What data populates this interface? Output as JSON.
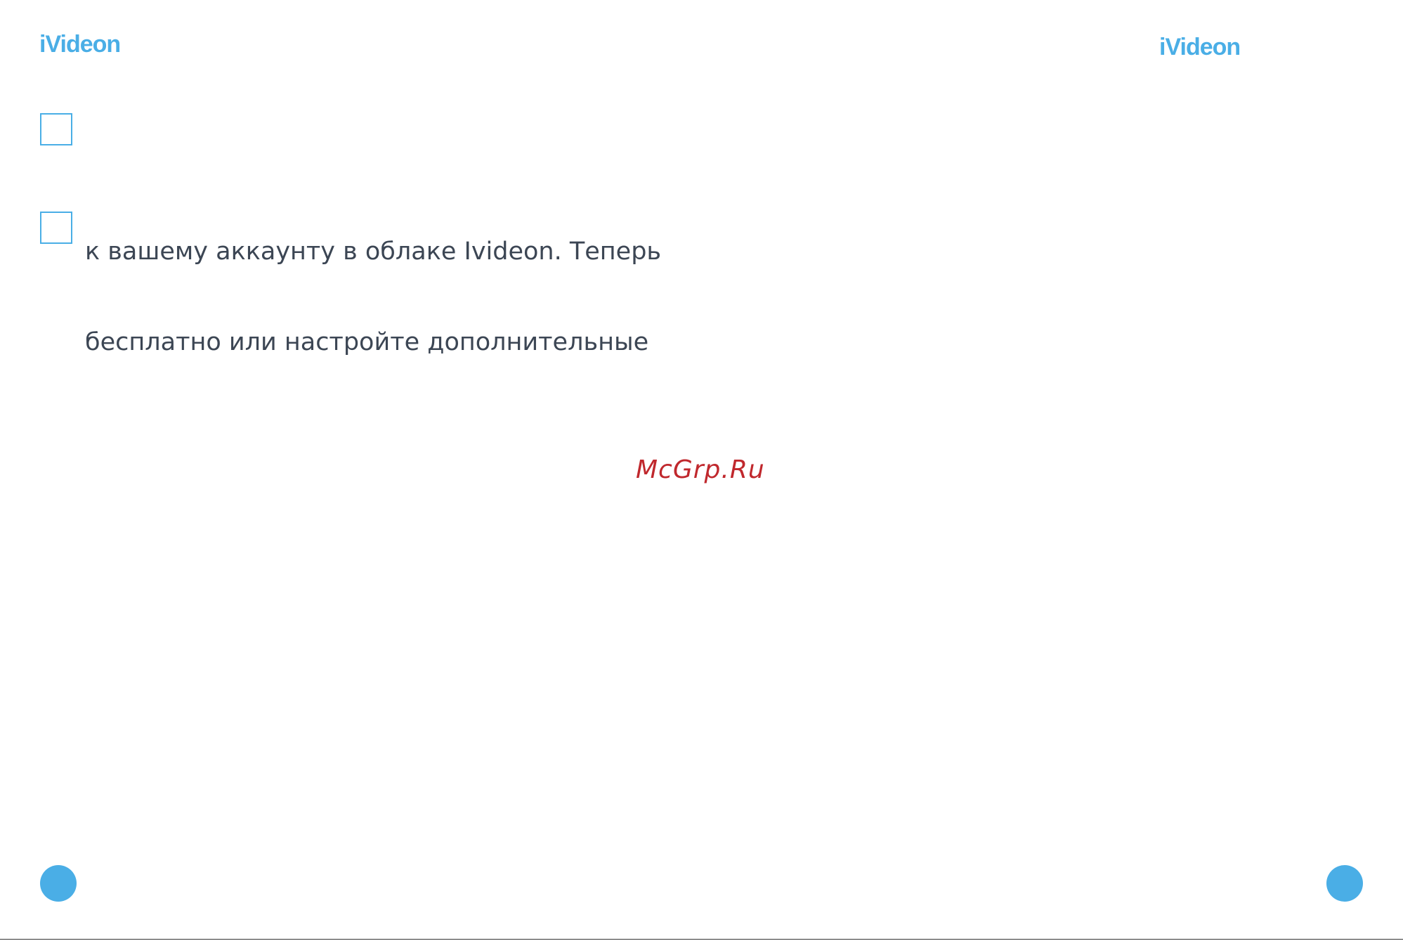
{
  "header": {
    "logo_left": "iVideon",
    "logo_right": "iVideon"
  },
  "content": {
    "line_1": "к вашему аккаунту в облаке Ivideon. Теперь",
    "line_2": "бесплатно или настройте дополнительные"
  },
  "watermark": "McGrp.Ru",
  "colors": {
    "accent": "#4aaee6",
    "text": "#3c4654",
    "watermark": "#c0282d"
  }
}
